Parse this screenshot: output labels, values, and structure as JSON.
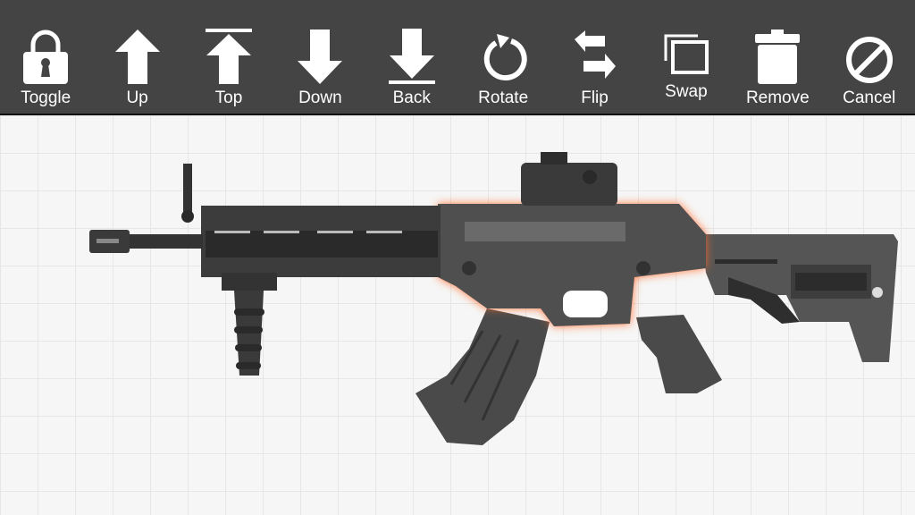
{
  "toolbar": {
    "buttons": [
      {
        "label": "Toggle",
        "icon": "lock-icon"
      },
      {
        "label": "Up",
        "icon": "arrow-up-icon"
      },
      {
        "label": "Top",
        "icon": "arrow-top-icon"
      },
      {
        "label": "Down",
        "icon": "arrow-down-icon"
      },
      {
        "label": "Back",
        "icon": "arrow-bottom-icon"
      },
      {
        "label": "Rotate",
        "icon": "rotate-icon"
      },
      {
        "label": "Flip",
        "icon": "flip-icon"
      },
      {
        "label": "Swap",
        "icon": "swap-icon"
      },
      {
        "label": "Remove",
        "icon": "trash-icon"
      },
      {
        "label": "Cancel",
        "icon": "cancel-icon"
      }
    ]
  },
  "colors": {
    "toolbar_bg": "#444444",
    "canvas_bg": "#f6f6f6",
    "selection_glow": "#ff6a2a",
    "gun_dark": "#3a3a3a",
    "gun_mid": "#555555"
  }
}
